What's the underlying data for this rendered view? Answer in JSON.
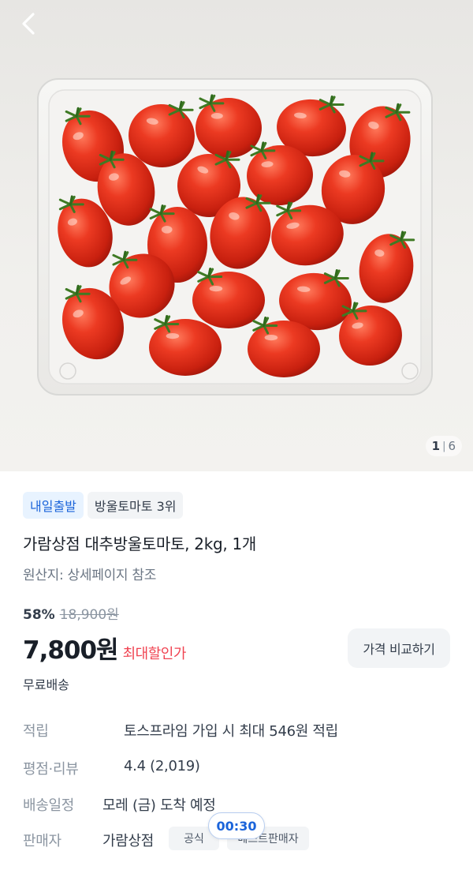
{
  "image": {
    "subject": "cherry tomatoes in clear plastic container",
    "counter_current": "1",
    "counter_total": "6"
  },
  "nav": {
    "back_icon": "chevron-left-icon"
  },
  "badges": [
    {
      "label": "내일출발",
      "color": "#1b64da",
      "bg": "#e8f3ff"
    },
    {
      "label": "방울토마토 3위",
      "color": "#333d4b",
      "bg": "#f2f4f6"
    }
  ],
  "product": {
    "title": "가람상점 대추방울토마토, 2kg, 1개",
    "origin": "원산지: 상세페이지 참조",
    "discount_rate": "58%",
    "original_price": "18,900원",
    "price": "7,800원",
    "price_tag": "최대할인가",
    "compare_button": "가격 비교하기",
    "shipping": "무료배송"
  },
  "specs": {
    "points_label": "적립",
    "points_value": "토스프라임 가입 시 최대 546원 적립",
    "rating_label": "평점·리뷰",
    "rating_value": "4.4 (2,019)",
    "delivery_label": "배송일정",
    "delivery_value": "모레 (금) 도착 예정",
    "seller_label": "판매자",
    "seller_value": "가람상점",
    "seller_chip_official": "공식",
    "seller_chip_best": "베스트판매자"
  },
  "timer": "00:30",
  "colors": {
    "accent": "#1b64da",
    "sale": "#f04452",
    "text": "#191f28",
    "muted": "#8b95a1"
  }
}
